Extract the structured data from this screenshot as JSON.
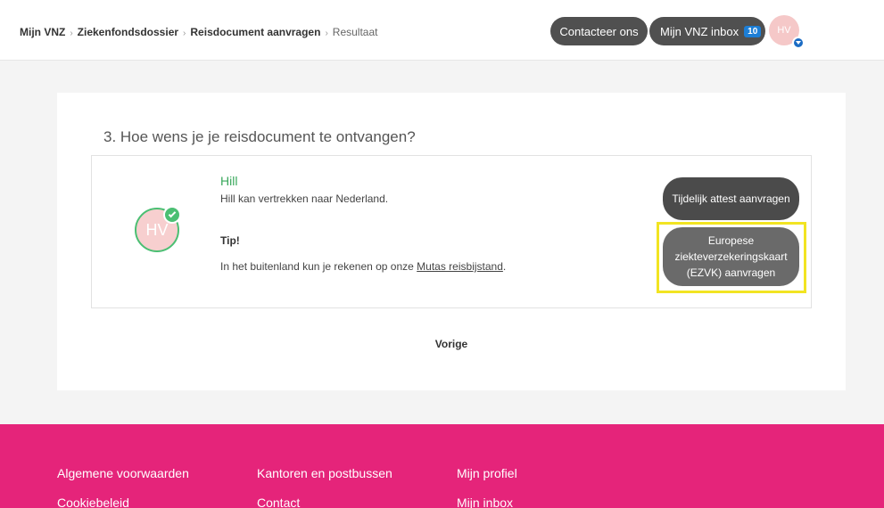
{
  "breadcrumb": {
    "items": [
      "Mijn VNZ",
      "Ziekenfondsdossier",
      "Reisdocument aanvragen"
    ],
    "current": "Resultaat",
    "separator": "›"
  },
  "header": {
    "contact_label": "Contacteer ons",
    "inbox_label": "Mijn VNZ inbox",
    "inbox_count": "10",
    "avatar_initials": "HV"
  },
  "main": {
    "question": "3. Hoe wens je je reisdocument te ontvangen?",
    "person": {
      "initials": "HV",
      "name": "Hill",
      "status_text": "Hill kan vertrekken naar Nederland."
    },
    "tip_title": "Tip!",
    "tip_text_prefix": "In het buitenland kun je rekenen op onze ",
    "tip_link": "Mutas reisbijstand",
    "tip_text_suffix": ".",
    "buttons": {
      "temporary": "Tijdelijk attest aanvragen",
      "ezvk": "Europese ziekteverzekeringskaart (EZVK) aanvragen"
    },
    "previous_label": "Vorige"
  },
  "footer": {
    "col1": [
      "Algemene voorwaarden",
      "Cookiebeleid"
    ],
    "col2": [
      "Kantoren en postbussen",
      "Contact"
    ],
    "col3": [
      "Mijn profiel",
      "Mijn inbox"
    ]
  },
  "colors": {
    "footer_bg": "#e5247a",
    "success": "#4bbf73",
    "highlight": "#f2e422",
    "button_dark": "#4b4b4b",
    "badge": "#1c7ed6"
  }
}
